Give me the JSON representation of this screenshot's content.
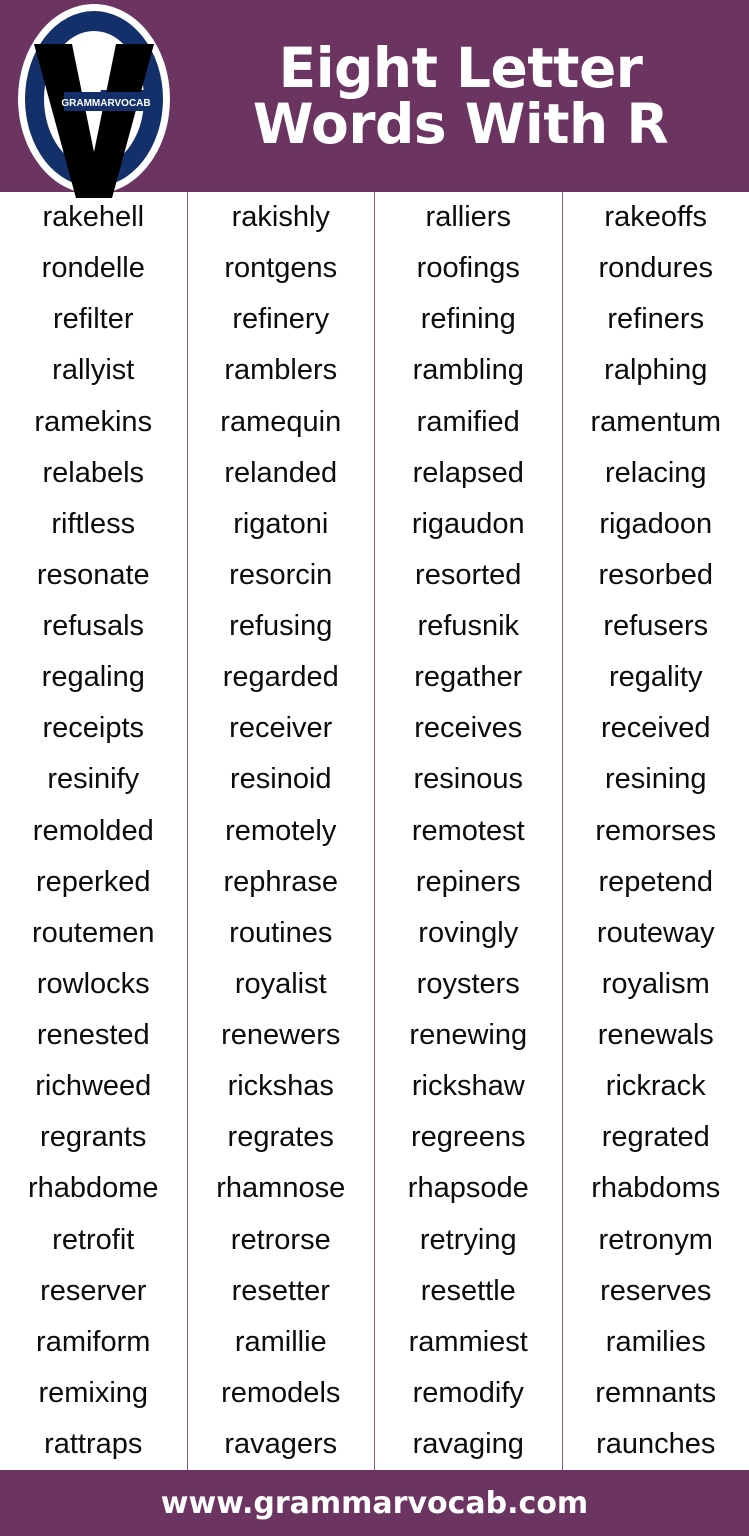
{
  "header": {
    "title_line1": "Eight Letter",
    "title_line2": "Words With R",
    "background_color": "#6B3461",
    "title_color": "#ffffff"
  },
  "logo": {
    "brand_text": "GRAMMARVOCAB",
    "ring_color": "#13306B",
    "letter_color": "#000000",
    "badge_color": "#13306B"
  },
  "table": {
    "divider_color": "#8A5F86",
    "text_color": "#0c0c0c",
    "columns": [
      {
        "words": [
          "rakehell",
          "rondelle",
          "refilter",
          "rallyist",
          "ramekins",
          "relabels",
          "riftless",
          "resonate",
          "refusals",
          "regaling",
          "receipts",
          "resinify",
          "remolded",
          "reperked",
          "routemen",
          "rowlocks",
          "renested",
          "richweed",
          "regrants",
          "rhabdome",
          "retrofit",
          "reserver",
          "ramiform",
          "remixing",
          "rattraps"
        ]
      },
      {
        "words": [
          "rakishly",
          "rontgens",
          "refinery",
          "ramblers",
          "ramequin",
          "relanded",
          "rigatoni",
          "resorcin",
          "refusing",
          "regarded",
          "receiver",
          "resinoid",
          "remotely",
          "rephrase",
          "routines",
          "royalist",
          "renewers",
          "rickshas",
          "regrates",
          "rhamnose",
          "retrorse",
          "resetter",
          "ramillie",
          "remodels",
          "ravagers"
        ]
      },
      {
        "words": [
          "ralliers",
          "roofings",
          "refining",
          "rambling",
          "ramified",
          "relapsed",
          "rigaudon",
          "resorted",
          "refusnik",
          "regather",
          "receives",
          "resinous",
          "remotest",
          "repiners",
          "rovingly",
          "roysters",
          "renewing",
          "rickshaw",
          "regreens",
          "rhapsode",
          "retrying",
          "resettle",
          "rammiest",
          "remodify",
          "ravaging"
        ]
      },
      {
        "words": [
          "rakeoffs",
          "rondures",
          "refiners",
          "ralphing",
          "ramentum",
          "relacing",
          "rigadoon",
          "resorbed",
          "refusers",
          "regality",
          "received",
          "resining",
          "remorses",
          "repetend",
          "routeway",
          "royalism",
          "renewals",
          "rickrack",
          "regrated",
          "rhabdoms",
          "retronym",
          "reserves",
          "ramilies",
          "remnants",
          "raunches"
        ]
      }
    ]
  },
  "footer": {
    "url": "www.grammarvocab.com",
    "background_color": "#6B3461",
    "text_color": "#ffffff"
  }
}
